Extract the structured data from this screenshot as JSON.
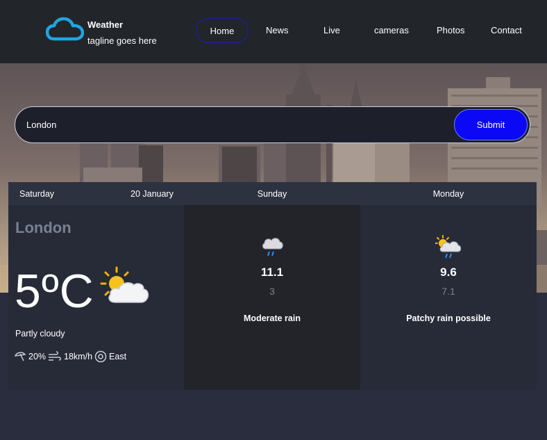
{
  "brand": {
    "title": "Weather",
    "tagline": "tagline goes here"
  },
  "nav": [
    "Home",
    "News",
    "Live",
    "cameras",
    "Photos",
    "Contact"
  ],
  "search": {
    "value": "London",
    "submit_label": "Submit"
  },
  "today": {
    "day": "Saturday",
    "date": "20 January",
    "city": "London",
    "temperature": "5ºC",
    "condition": "Partly cloudy",
    "icon": "partly-cloudy-icon",
    "rain_chance": "20%",
    "wind_speed": "18km/h",
    "wind_direction": "East"
  },
  "forecast": [
    {
      "day": "Sunday",
      "max": "11.1",
      "min": "3",
      "condition": "Moderate rain",
      "icon": "rain-cloud-icon"
    },
    {
      "day": "Monday",
      "max": "9.6",
      "min": "7.1",
      "condition": "Patchy rain possible",
      "icon": "sun-rain-cloud-icon"
    }
  ],
  "colors": {
    "header_bg": "#22252a",
    "page_bg": "#292d3e",
    "submit_bg": "#0a08f5",
    "logo_accent": "#1ea6e0"
  }
}
